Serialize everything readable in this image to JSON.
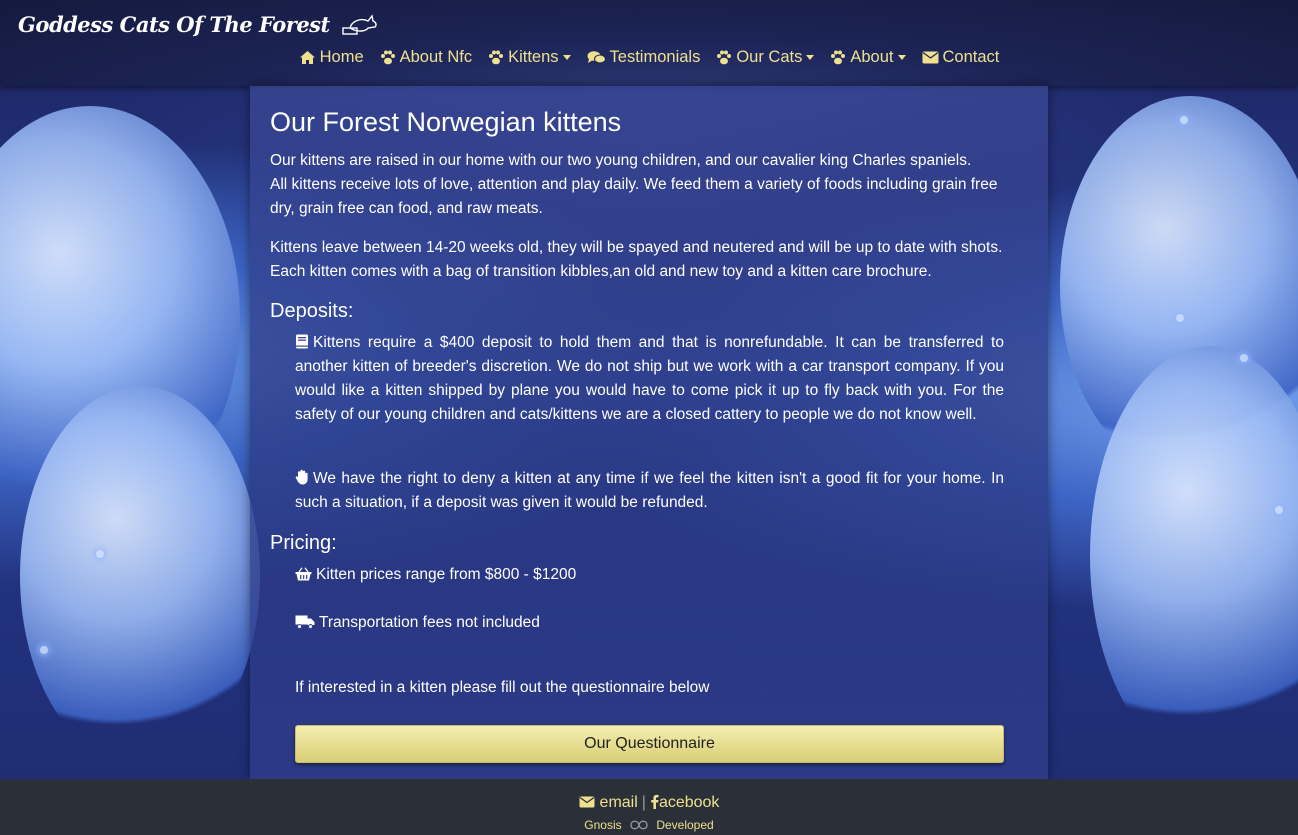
{
  "brand": {
    "name": "Goddess Cats Of The Forest"
  },
  "nav": {
    "items": [
      {
        "label": "Home",
        "icon": "home-icon"
      },
      {
        "label": "About Nfc",
        "icon": "paw-icon"
      },
      {
        "label": "Kittens",
        "icon": "paw-icon",
        "dropdown": true
      },
      {
        "label": "Testimonials",
        "icon": "comments-icon"
      },
      {
        "label": "Our Cats",
        "icon": "paw-icon",
        "dropdown": true
      },
      {
        "label": "About",
        "icon": "paw-icon",
        "dropdown": true
      },
      {
        "label": "Contact",
        "icon": "envelope-icon"
      }
    ]
  },
  "main": {
    "title": "Our Forest Norwegian kittens",
    "intro_1": "Our kittens are raised in our home with our two young children, and our cavalier king Charles spaniels.",
    "intro_2": "All kittens receive lots of love, attention and play daily. We feed them a variety of foods including grain free",
    "intro_3": "dry, grain free can food, and raw meats.",
    "leave_1": "Kittens leave between 14-20 weeks old, they will be spayed and neutered and will be up to date with shots.",
    "leave_2": "Each kitten comes with a bag of transition kibbles,an old and new toy and a kitten care brochure.",
    "deposits_heading": "Deposits:",
    "deposit_text": "Kittens require a $400 deposit to hold them and that is nonrefundable. It can be transferred to another kitten of breeder's discretion. We do not ship but we work with a car transport company. If you would like a kitten shipped by plane you would have to come pick it up to fly back with you. For the safety of our young children and cats/kittens we are a closed cattery to people we do not know well.",
    "deny_text": "We have the right to deny a kitten at any time if we feel the kitten isn't a good fit for your home. In such a situation, if a deposit was given it would be refunded.",
    "pricing_heading": "Pricing:",
    "price_text": "Kitten prices range from $800 - $1200",
    "transport_text": "Transportation fees not included",
    "interest_text": "If interested in a kitten please fill out the questionnaire below",
    "button_label": "Our Questionnaire"
  },
  "footer": {
    "email_label": "email",
    "separator": "|",
    "facebook_label": "acebook",
    "developer_left": "Gnosis",
    "developer_right": "Developed"
  },
  "colors": {
    "accent": "#eee08f",
    "button": "#e5dc8d",
    "footer": "#2a2f38"
  }
}
